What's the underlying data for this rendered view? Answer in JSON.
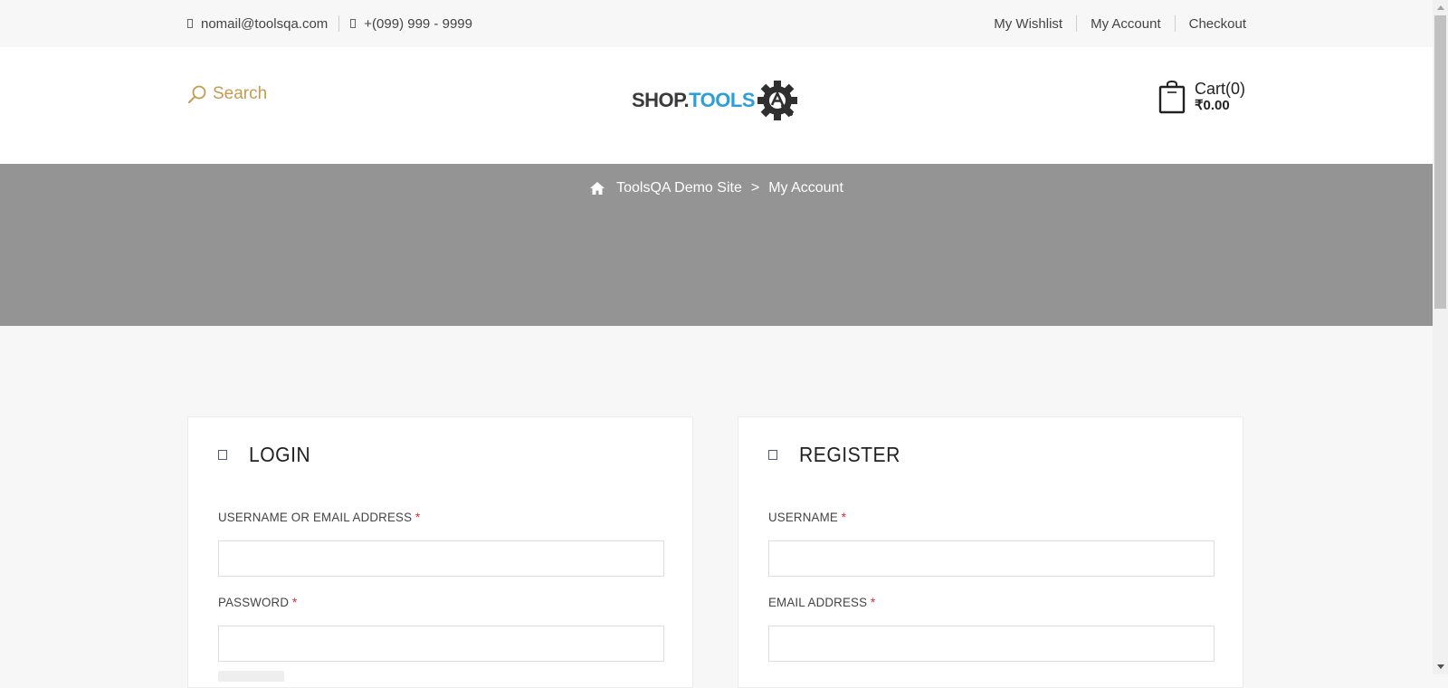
{
  "topbar": {
    "email": "nomail@toolsqa.com",
    "phone": "+(099) 999 - 9999",
    "links": [
      "My Wishlist",
      "My Account",
      "Checkout"
    ]
  },
  "header": {
    "search_label": "Search",
    "logo": {
      "part1": "SHOP.",
      "part2": "TOOLS"
    },
    "cart": {
      "label": "Cart(0)",
      "price": "₹0.00"
    }
  },
  "breadcrumb": {
    "home": "ToolsQA Demo Site",
    "separator": ">",
    "current": "My Account"
  },
  "login": {
    "title": "LOGIN",
    "username_label": "USERNAME OR EMAIL ADDRESS",
    "password_label": "PASSWORD",
    "required_mark": "*"
  },
  "register": {
    "title": "REGISTER",
    "username_label": "USERNAME",
    "email_label": "EMAIL ADDRESS",
    "required_mark": "*"
  },
  "colors": {
    "accent": "#c59a52",
    "logo_blue": "#2c9fd9",
    "banner": "#949494",
    "required": "#e3242b"
  }
}
